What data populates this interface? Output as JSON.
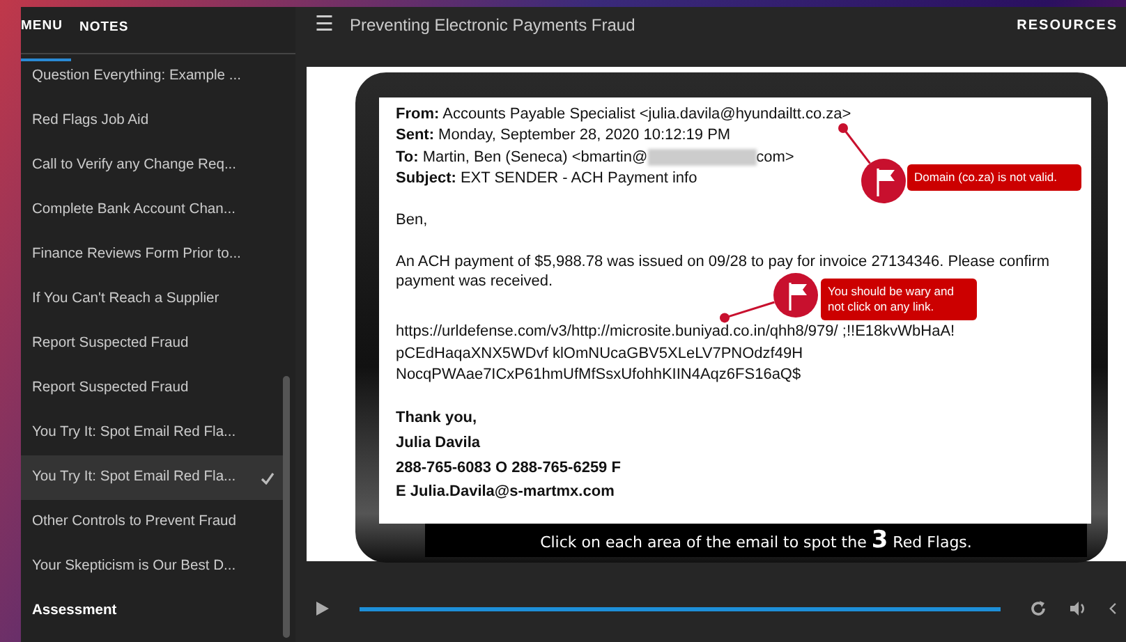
{
  "sidebar": {
    "tabs": [
      {
        "label": "MENU",
        "selected": true
      },
      {
        "label": "NOTES",
        "selected": false
      }
    ],
    "items": [
      {
        "label": "Question Everything: Example ...",
        "selected": false,
        "checked": false
      },
      {
        "label": "Red Flags Job Aid",
        "selected": false,
        "checked": false
      },
      {
        "label": "Call to Verify any Change Req...",
        "selected": false,
        "checked": false
      },
      {
        "label": "Complete Bank Account Chan...",
        "selected": false,
        "checked": false
      },
      {
        "label": "Finance Reviews Form Prior to...",
        "selected": false,
        "checked": false
      },
      {
        "label": "If You Can't Reach a Supplier",
        "selected": false,
        "checked": false
      },
      {
        "label": "Report Suspected Fraud",
        "selected": false,
        "checked": false
      },
      {
        "label": "Report Suspected Fraud",
        "selected": false,
        "checked": false
      },
      {
        "label": "You Try It: Spot Email Red Fla...",
        "selected": false,
        "checked": false
      },
      {
        "label": "You Try It: Spot Email Red Fla...",
        "selected": true,
        "checked": true
      },
      {
        "label": "Other Controls to Prevent Fraud",
        "selected": false,
        "checked": false
      },
      {
        "label": "Your Skepticism is Our Best D...",
        "selected": false,
        "checked": false
      },
      {
        "label": "Assessment",
        "selected": false,
        "checked": false,
        "kind": "section"
      }
    ]
  },
  "header": {
    "menu_icon": "☰",
    "title": "Preventing Electronic Payments Fraud",
    "resources": "RESOURCES"
  },
  "email": {
    "headers": [
      {
        "label": "From:",
        "value": "Accounts Payable Specialist <julia.davila@hyundailtt.co.za>"
      },
      {
        "label": "Sent:",
        "value": "Monday, September 28, 2020 10:12:19 PM"
      },
      {
        "label": "To:",
        "value": "Martin, Ben (Seneca) <bmartin@",
        "redacted": true,
        "value_end": "com>"
      },
      {
        "label": "Subject:",
        "value": "EXT SENDER - ACH Payment info"
      }
    ],
    "greeting": "Ben,",
    "body_lines": [
      "An ACH payment of $5,988.78 was issued on 09/28 to pay for invoice 27134346. Please confirm",
      "payment was received."
    ],
    "link_lines": [
      "https://urldefense.com/v3/http://microsite.buniyad.co.in/qhh8/979/ ;!!E18kvWbHaA!",
      "pCEdHaqaXNX5WDvf klOmNUcaGBV5XLeLV7PNOdzf49H",
      "NocqPWAae7ICxP61hmUfMfSsxUfohhKIIN4Aqz6FS16aQ$"
    ],
    "signature": [
      "Thank you,",
      "Julia Davila",
      "288-765-6083 O 288-765-6259 F",
      "E Julia.Davila@s-martmx.com"
    ]
  },
  "flags": [
    {
      "text": "Domain (co.za) is not valid."
    },
    {
      "text": "You should be wary and not click on any link."
    }
  ],
  "instruction": {
    "before": "Click on each area of the email to spot the",
    "count": "3",
    "after": "Red Flags."
  },
  "player": {
    "level": 1
  }
}
